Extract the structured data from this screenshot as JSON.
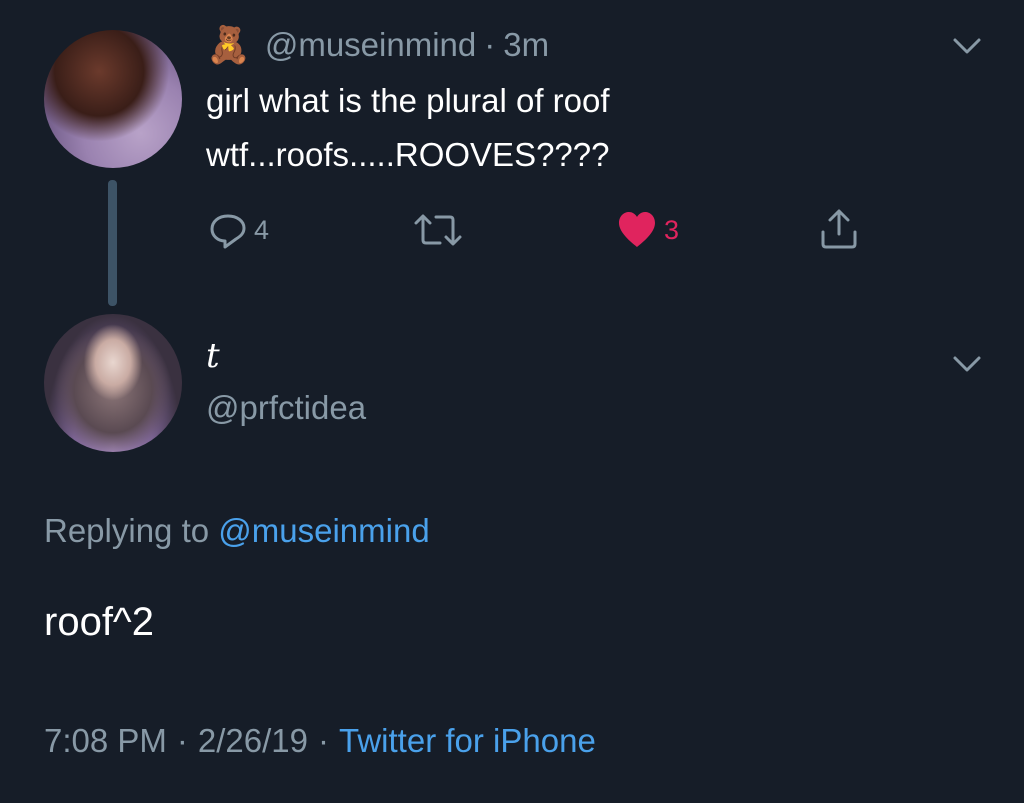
{
  "tweet1": {
    "emoji": "🧸",
    "handle": "@museinmind",
    "separator": "·",
    "time": "3m",
    "text_line1": "girl what is the plural of roof",
    "text_line2": "wtf...roofs.....ROOVES????",
    "reply_count": "4",
    "like_count": "3"
  },
  "tweet2": {
    "display_name": "𝑡",
    "handle": "@prfctidea",
    "replying_label": "Replying to",
    "replying_handle": "@museinmind",
    "text": "roof^2",
    "time": "7:08 PM",
    "separator1": "·",
    "date": "2/26/19",
    "separator2": "·",
    "source": "Twitter for iPhone"
  },
  "colors": {
    "background": "#161d28",
    "like": "#e0245e",
    "link": "#4aa1eb",
    "muted": "#8899a6"
  }
}
